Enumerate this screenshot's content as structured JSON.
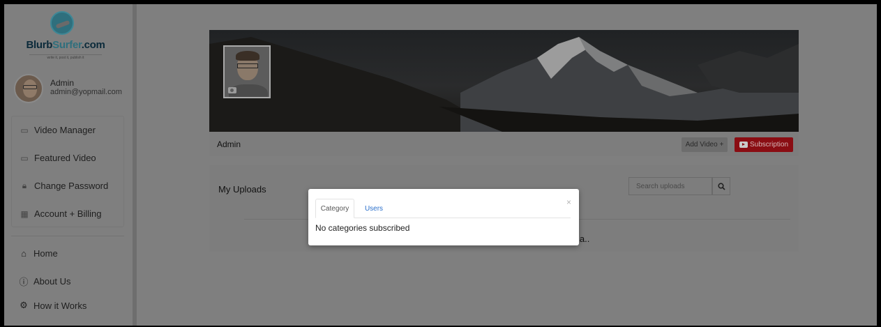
{
  "brand": {
    "logo_main": "Blurb",
    "logo_accent": "Surfer",
    "logo_suffix": ".com",
    "tagline": "write it, post it, publish it"
  },
  "profile": {
    "name": "Admin",
    "email": "admin@yopmail.com"
  },
  "sidebar": {
    "menu": [
      {
        "label": "Video Manager",
        "icon": "film-icon"
      },
      {
        "label": "Featured Video",
        "icon": "film-icon"
      },
      {
        "label": "Change Password",
        "icon": "lock-icon"
      },
      {
        "label": "Account + Billing",
        "icon": "billing-icon"
      }
    ],
    "nav": [
      {
        "label": "Home",
        "icon": "home-icon"
      },
      {
        "label": "About Us",
        "icon": "info-icon"
      },
      {
        "label": "How it Works",
        "icon": "gears-icon"
      }
    ]
  },
  "channel": {
    "name": "Admin",
    "add_video_label": "Add Video +",
    "subscription_label": "Subscription"
  },
  "uploads": {
    "title": "My Uploads",
    "search_placeholder": "Search uploads",
    "partial_text": "ia.."
  },
  "modal": {
    "tabs": [
      "Category",
      "Users"
    ],
    "active_tab": "Category",
    "message": "No categories subscribed",
    "close_glyph": "×"
  },
  "colors": {
    "overlay": "#7f7f7f",
    "subscription_button": "#8a0d13",
    "active_link": "#2a6fcb"
  }
}
